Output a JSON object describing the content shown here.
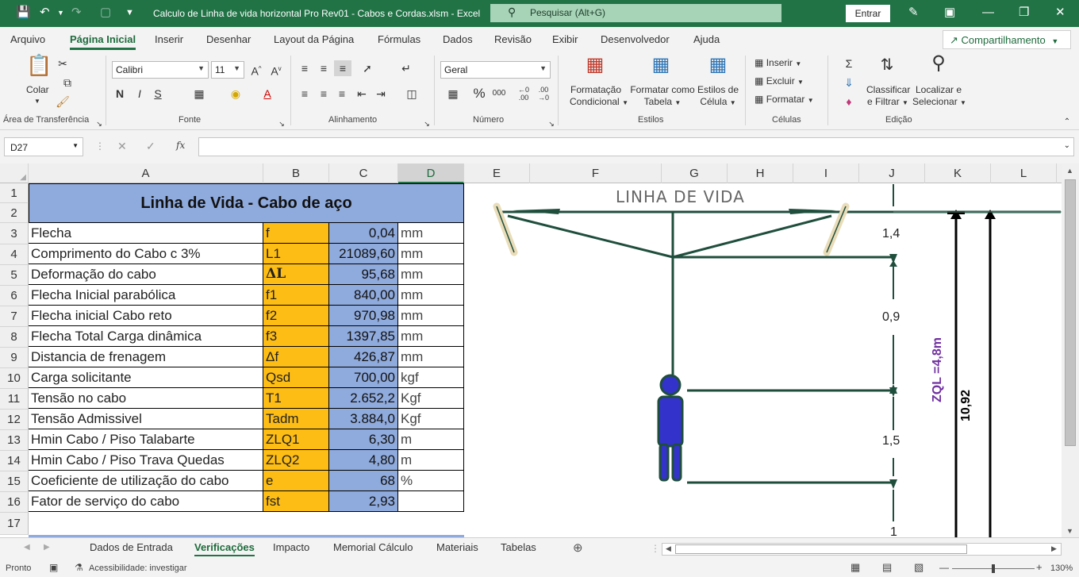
{
  "titlebar": {
    "filename": "Calculo de Linha de vida horizontal  Pro Rev01 - Cabos e Cordas.xlsm  -  Excel",
    "search_placeholder": "Pesquisar (Alt+G)",
    "signin": "Entrar",
    "accent": "#217346"
  },
  "menu": [
    "Arquivo",
    "Página Inicial",
    "Inserir",
    "Desenhar",
    "Layout da Página",
    "Fórmulas",
    "Dados",
    "Revisão",
    "Exibir",
    "Desenvolvedor",
    "Ajuda"
  ],
  "share": "Compartilhamento",
  "ribbon": {
    "paste": "Colar",
    "font_name": "Calibri",
    "font_size": "11",
    "bold": "N",
    "italic": "I",
    "underline": "S",
    "number_format": "Geral",
    "percent": "%",
    "thousands": "000",
    "cond_format": [
      "Formatação",
      "Condicional"
    ],
    "format_table": [
      "Formatar como",
      "Tabela"
    ],
    "cell_styles": [
      "Estilos de",
      "Célula"
    ],
    "insert": "Inserir",
    "delete": "Excluir",
    "format": "Formatar",
    "sort": [
      "Classificar",
      "e Filtrar"
    ],
    "find": [
      "Localizar e",
      "Selecionar"
    ],
    "groups": {
      "clipboard": "Área de Transferência",
      "font": "Fonte",
      "alignment": "Alinhamento",
      "number": "Número",
      "styles": "Estilos",
      "cells": "Células",
      "editing": "Edição"
    }
  },
  "formula_bar": {
    "name_box": "D27",
    "fx": "fx",
    "content": ""
  },
  "columns": [
    "A",
    "B",
    "C",
    "D",
    "E",
    "F",
    "G",
    "H",
    "I",
    "J",
    "K",
    "L"
  ],
  "rows": [
    "1",
    "2",
    "3",
    "4",
    "5",
    "6",
    "7",
    "8",
    "9",
    "10",
    "11",
    "12",
    "13",
    "14",
    "15",
    "16",
    "17"
  ],
  "sheet": {
    "title": "Linha de Vida - Cabo de aço",
    "table": [
      {
        "label": "Flecha",
        "sym": "f",
        "val": "0,04",
        "unit": "mm"
      },
      {
        "label": "Comprimento do Cabo c 3%",
        "sym": "L1",
        "val": "21089,60",
        "unit": "mm"
      },
      {
        "label": "Deformação do cabo",
        "sym": "ΔL",
        "val": "95,68",
        "unit": "mm"
      },
      {
        "label": "Flecha Inicial parabólica",
        "sym": "f1",
        "val": "840,00",
        "unit": "mm"
      },
      {
        "label": "Flecha inicial Cabo reto",
        "sym": "f2",
        "val": "970,98",
        "unit": "mm"
      },
      {
        "label": "Flecha Total Carga dinâmica",
        "sym": "f3",
        "val": "1397,85",
        "unit": "mm"
      },
      {
        "label": "Distancia de frenagem",
        "sym": "Δf",
        "val": "426,87",
        "unit": "mm"
      },
      {
        "label": "Carga solicitante",
        "sym": "Qsd",
        "val": "700,00",
        "unit": "kgf"
      },
      {
        "label": "Tensão no cabo",
        "sym": "T1",
        "val": "2.652,2",
        "unit": "Kgf"
      },
      {
        "label": "Tensão Admissivel",
        "sym": "Tadm",
        "val": "3.884,0",
        "unit": "Kgf"
      },
      {
        "label": "Hmin Cabo / Piso Talabarte",
        "sym": "ZLQ1",
        "val": "6,30",
        "unit": "m"
      },
      {
        "label": "Hmin Cabo / Piso Trava Quedas",
        "sym": "ZLQ2",
        "val": "4,80",
        "unit": "m"
      },
      {
        "label": "Coeficiente de utilização do cabo",
        "sym": "e",
        "val": "68",
        "unit": "%"
      },
      {
        "label": "Fator de serviço do cabo",
        "sym": "fst",
        "val": "2,93",
        "unit": ""
      }
    ]
  },
  "diagram": {
    "title": "LINHA DE VIDA",
    "dims": [
      "1,4",
      "0,9",
      "1,5",
      "1"
    ],
    "zql": "ZQL =4,8m",
    "height": "10,92"
  },
  "tabs": [
    "Dados de Entrada",
    "Verificações",
    "Impacto",
    "Memorial Cálculo",
    "Materiais",
    "Tabelas"
  ],
  "status": {
    "ready": "Pronto",
    "accessibility": "Acessibilidade: investigar",
    "zoom": "130%"
  }
}
